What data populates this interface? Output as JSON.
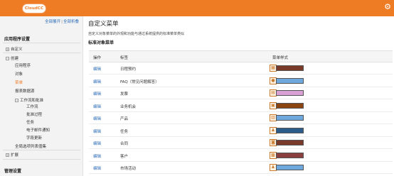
{
  "header": {
    "logo_text": "CloudCC",
    "settings_icon": "gear-icon"
  },
  "sidebar": {
    "expand_all": "全部展开",
    "separator": "|",
    "collapse_all": "全部折叠",
    "app_settings": "应用程序设置",
    "custom": "自定义",
    "create": "创建",
    "items": [
      "应用程序",
      "对象",
      "菜单",
      "报表数据源"
    ],
    "workflow": "工作流和批准",
    "workflow_items": [
      "工作流",
      "批准过程",
      "任务",
      "电子邮件通知",
      "字段更新"
    ],
    "global_picklist": "全局选项列表值集",
    "extend": "扩展",
    "admin_settings": "管理设置"
  },
  "main": {
    "title": "自定义菜单",
    "description": "自定义对象菜单的外观和功能与通过系统提供的标准菜单类似",
    "section_title": "标准对象菜单",
    "columns": {
      "action": "操作",
      "label": "标签",
      "style": "菜单样式"
    },
    "rows": [
      {
        "action": "编辑",
        "label": "日程预约",
        "icon": "calendar-icon",
        "color": "#7a3a2a"
      },
      {
        "action": "编辑",
        "label": "FAQ（常见问题解答）",
        "icon": "lightbulb-icon",
        "color": "#6fa8dc"
      },
      {
        "action": "编辑",
        "label": "发票",
        "icon": "invoice-icon",
        "color": "#d9a0d5"
      },
      {
        "action": "编辑",
        "label": "业务机会",
        "icon": "briefcase-icon",
        "color": "#8b4513"
      },
      {
        "action": "编辑",
        "label": "产品",
        "icon": "box-icon",
        "color": "#6fa8dc"
      },
      {
        "action": "编辑",
        "label": "任务",
        "icon": "person-icon",
        "color": "#2c5d8a"
      },
      {
        "action": "编辑",
        "label": "合同",
        "icon": "contract-icon",
        "color": "#7a3a2a"
      },
      {
        "action": "编辑",
        "label": "客户",
        "icon": "account-icon",
        "color": "#8b4040"
      },
      {
        "action": "编辑",
        "label": "市场活动",
        "icon": "campaign-icon",
        "color": "#6fa8dc"
      }
    ]
  }
}
